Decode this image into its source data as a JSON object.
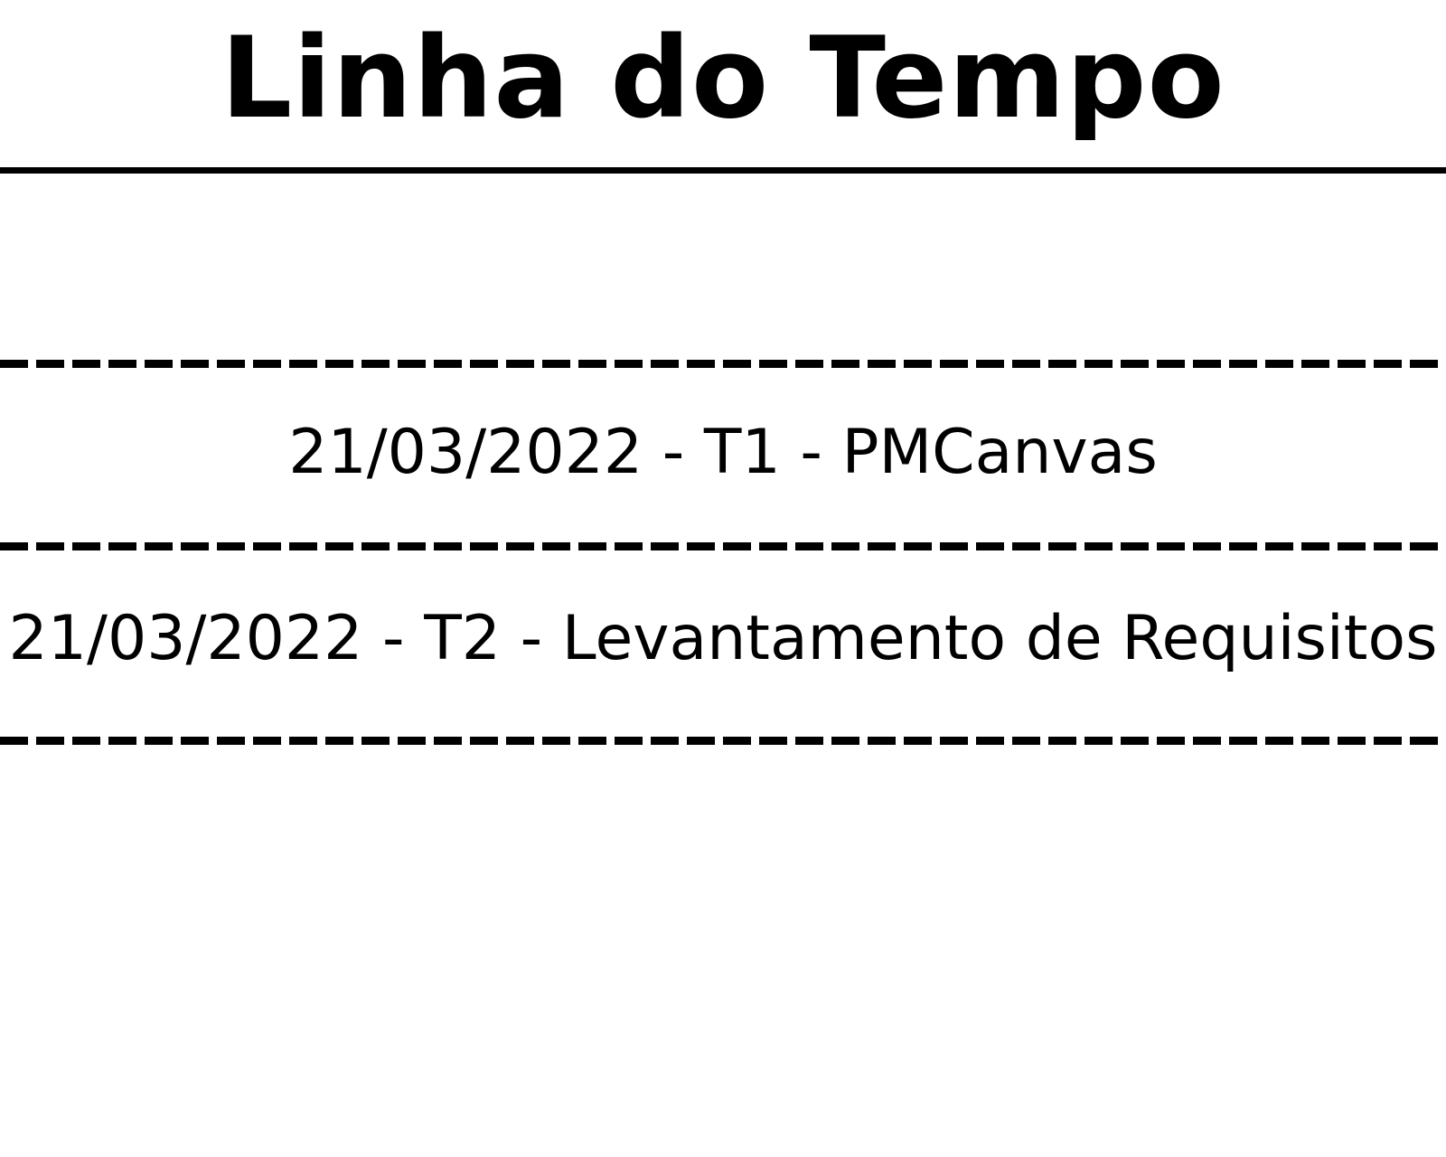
{
  "header": {
    "title": "Linha do Tempo"
  },
  "timeline": {
    "entries": [
      {
        "text": "21/03/2022 - T1 - PMCanvas"
      },
      {
        "text": "21/03/2022 - T2 - Levantamento de Requisitos"
      }
    ]
  },
  "colors": {
    "text": "#000000",
    "background": "#ffffff"
  }
}
